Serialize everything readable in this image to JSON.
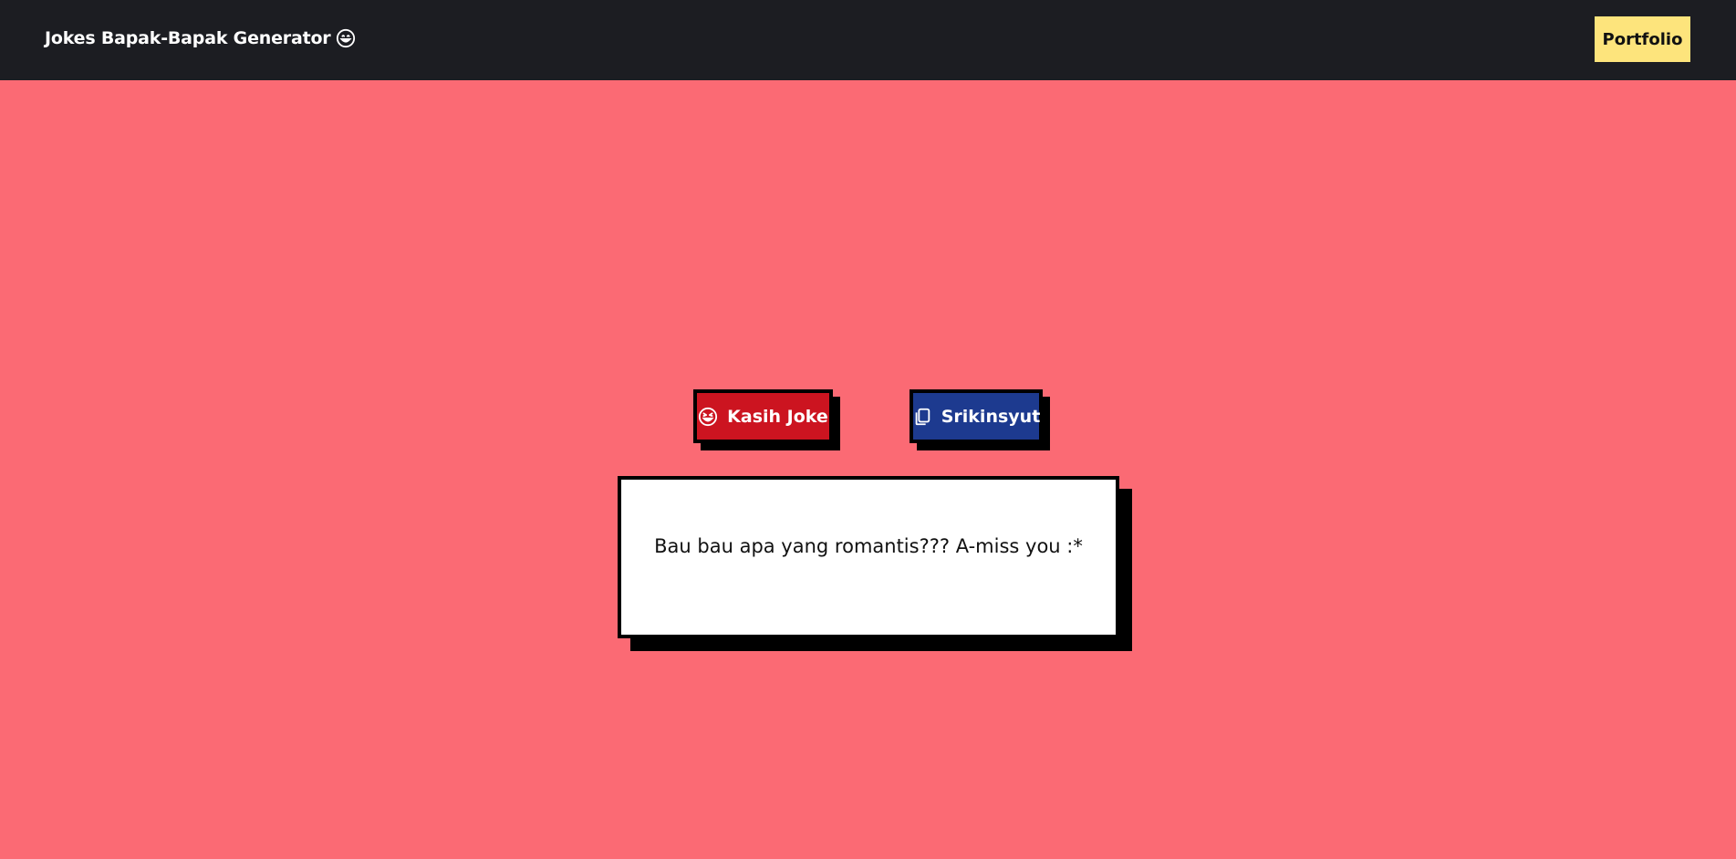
{
  "header": {
    "title": "Jokes Bapak-Bapak Generator",
    "title_icon": "smile-icon",
    "portfolio_label": "Portfolio",
    "portfolio_color": "#fde47c",
    "background": "#1c1d22"
  },
  "actions": {
    "joke_label": "Kasih Joke",
    "joke_icon": "laugh-icon",
    "joke_color": "#cc1420",
    "copy_label": "Srikinsyut",
    "copy_icon": "copy-icon",
    "copy_color": "#1d3a8f"
  },
  "joke": {
    "text": "Bau bau apa yang romantis??? A-miss you :*"
  },
  "theme": {
    "page_background": "#fb6a74"
  }
}
